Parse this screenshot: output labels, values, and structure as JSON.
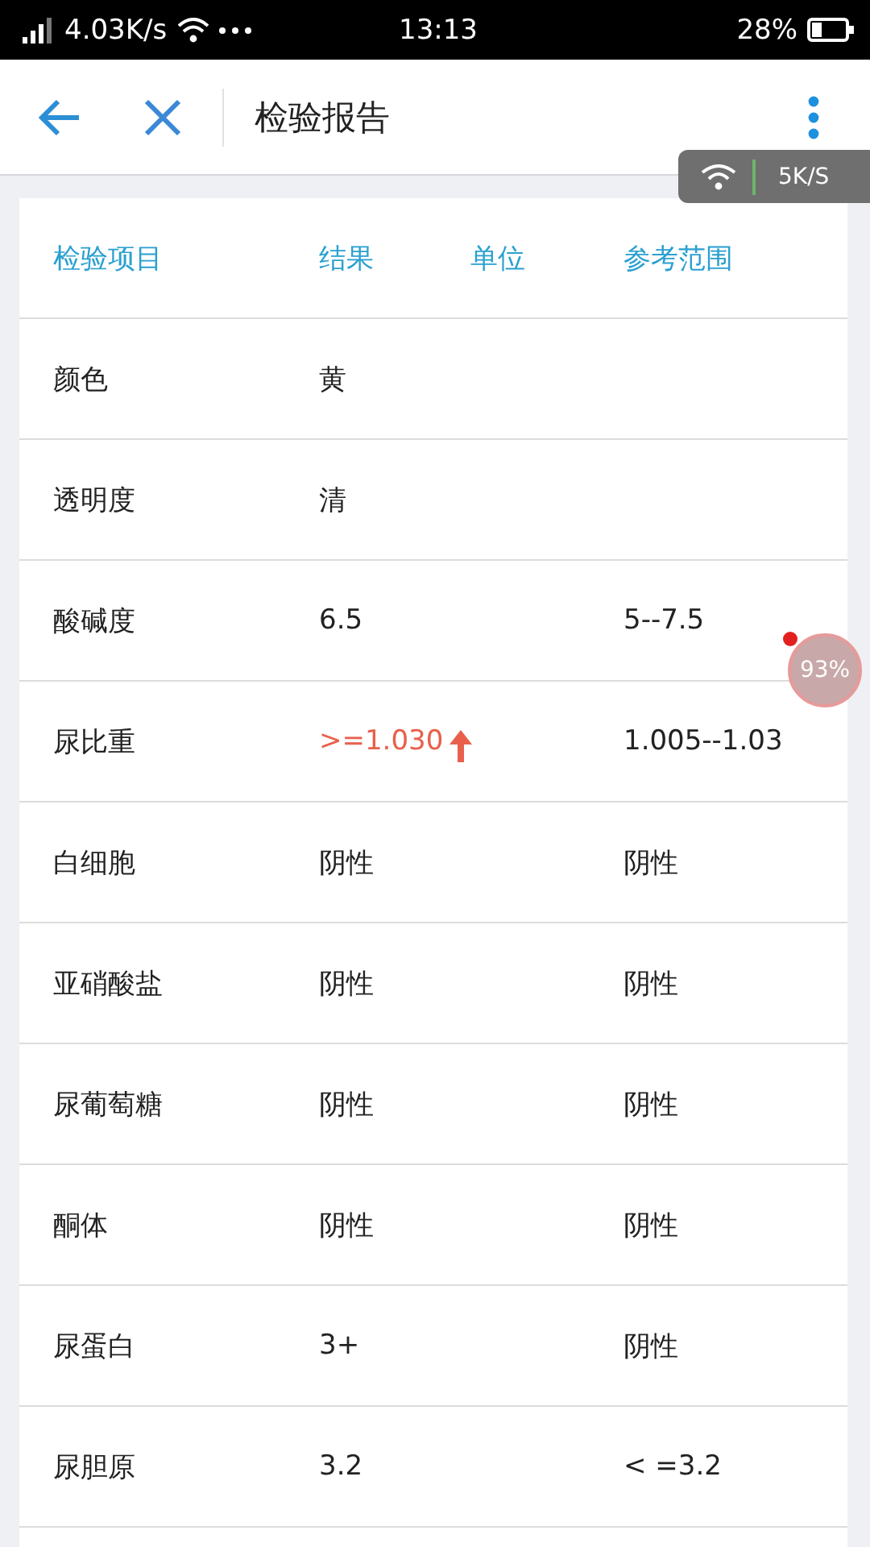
{
  "status_bar": {
    "speed": "4.03K/s",
    "time": "13:13",
    "battery": "28%"
  },
  "app_bar": {
    "title": "检验报告"
  },
  "net_overlay": {
    "speed": "5K/S"
  },
  "float_ball": {
    "reading": "93%"
  },
  "table": {
    "columns": [
      "检验项目",
      "结果",
      "单位",
      "参考范围"
    ],
    "rows": [
      {
        "name": "颜色",
        "result": "黄",
        "range": "",
        "high": false
      },
      {
        "name": "透明度",
        "result": "清",
        "range": "",
        "high": false
      },
      {
        "name": "酸碱度",
        "result": "6.5",
        "range": "5--7.5",
        "high": false
      },
      {
        "name": "尿比重",
        "result": ">=1.030",
        "range": "1.005--1.03",
        "high": true
      },
      {
        "name": "白细胞",
        "result": "阴性",
        "range": "阴性",
        "high": false
      },
      {
        "name": "亚硝酸盐",
        "result": "阴性",
        "range": "阴性",
        "high": false
      },
      {
        "name": "尿葡萄糖",
        "result": "阴性",
        "range": "阴性",
        "high": false
      },
      {
        "name": "酮体",
        "result": "阴性",
        "range": "阴性",
        "high": false
      },
      {
        "name": "尿蛋白",
        "result": "3+",
        "range": "阴性",
        "high": false
      },
      {
        "name": "尿胆原",
        "result": "3.2",
        "range": "< =3.2",
        "high": false
      }
    ]
  }
}
